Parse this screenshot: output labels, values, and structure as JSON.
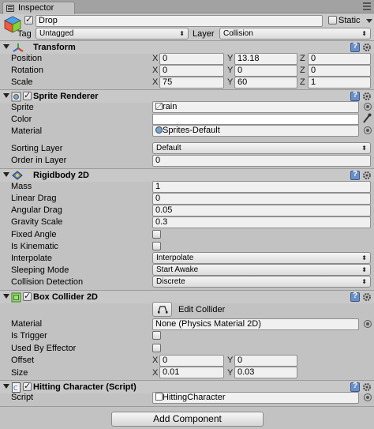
{
  "window": {
    "tab_label": "Inspector"
  },
  "object": {
    "active": true,
    "name": "Drop",
    "static_label": "Static",
    "static": false,
    "tag_label": "Tag",
    "tag": "Untagged",
    "layer_label": "Layer",
    "layer": "Collision"
  },
  "transform": {
    "title": "Transform",
    "position_label": "Position",
    "rotation_label": "Rotation",
    "scale_label": "Scale",
    "x": "X",
    "y": "Y",
    "z": "Z",
    "position": [
      "0",
      "13.18",
      "0"
    ],
    "rotation": [
      "0",
      "0",
      "0"
    ],
    "scale": [
      "75",
      "60",
      "1"
    ]
  },
  "sprite_renderer": {
    "title": "Sprite Renderer",
    "enabled": true,
    "sprite_label": "Sprite",
    "sprite": "rain",
    "color_label": "Color",
    "color": "#ffffff",
    "material_label": "Material",
    "material": "Sprites-Default",
    "sorting_layer_label": "Sorting Layer",
    "sorting_layer": "Default",
    "order_label": "Order in Layer",
    "order": "0"
  },
  "rigidbody": {
    "title": "Rigidbody 2D",
    "mass_label": "Mass",
    "mass": "1",
    "linear_drag_label": "Linear Drag",
    "linear_drag": "0",
    "angular_drag_label": "Angular Drag",
    "angular_drag": "0.05",
    "gravity_label": "Gravity Scale",
    "gravity": "0.3",
    "fixed_angle_label": "Fixed Angle",
    "kinematic_label": "Is Kinematic",
    "interpolate_label": "Interpolate",
    "interpolate": "Interpolate",
    "sleeping_label": "Sleeping Mode",
    "sleeping": "Start Awake",
    "collision_label": "Collision Detection",
    "collision": "Discrete"
  },
  "box_collider": {
    "title": "Box Collider 2D",
    "enabled": true,
    "edit_label": "Edit Collider",
    "material_label": "Material",
    "material": "None (Physics Material 2D)",
    "trigger_label": "Is Trigger",
    "effector_label": "Used By Effector",
    "offset_label": "Offset",
    "size_label": "Size",
    "x": "X",
    "y": "Y",
    "offset": [
      "0",
      "0"
    ],
    "size": [
      "0.01",
      "0.03"
    ]
  },
  "script": {
    "title": "Hitting Character (Script)",
    "enabled": true,
    "script_label": "Script",
    "script": "HittingCharacter"
  },
  "add_component_label": "Add Component"
}
